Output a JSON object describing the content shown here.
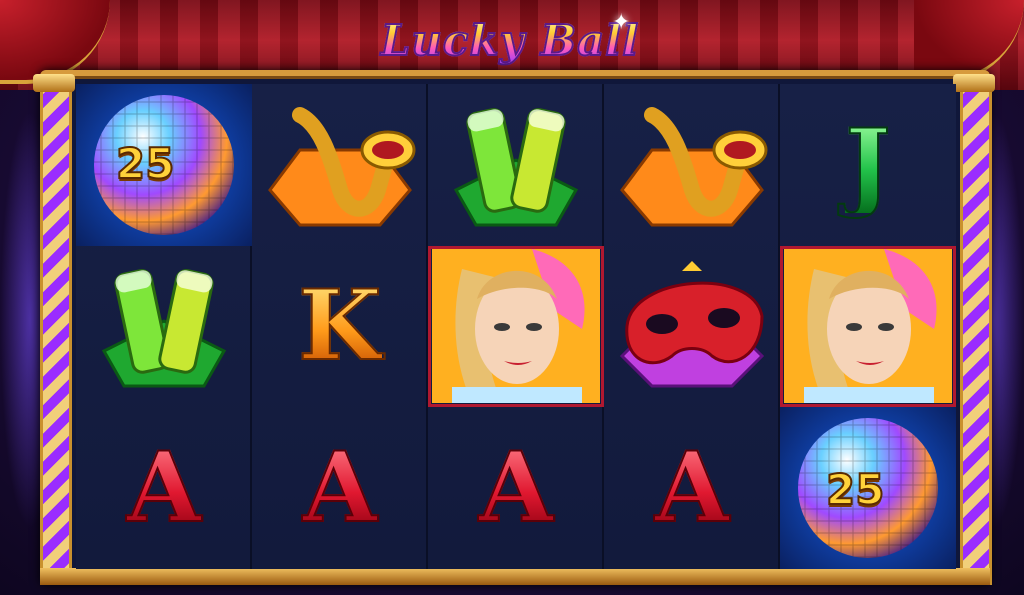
{
  "game": {
    "title": "Lucky Ball"
  },
  "reels": [
    [
      {
        "symbol": "disco-ball",
        "value": "25"
      },
      {
        "symbol": "champagne-glasses"
      },
      {
        "symbol": "letter-A",
        "label": "A"
      }
    ],
    [
      {
        "symbol": "saxophone"
      },
      {
        "symbol": "letter-K",
        "label": "K"
      },
      {
        "symbol": "letter-A",
        "label": "A"
      }
    ],
    [
      {
        "symbol": "champagne-glasses"
      },
      {
        "symbol": "showgirl"
      },
      {
        "symbol": "letter-A",
        "label": "A"
      }
    ],
    [
      {
        "symbol": "saxophone"
      },
      {
        "symbol": "masquerade-mask"
      },
      {
        "symbol": "letter-A",
        "label": "A"
      }
    ],
    [
      {
        "symbol": "letter-J",
        "label": "J"
      },
      {
        "symbol": "showgirl"
      },
      {
        "symbol": "disco-ball",
        "value": "25"
      }
    ]
  ],
  "colors": {
    "frame_gold": "#d79a3c",
    "reel_bg": "#172046",
    "curtain_red": "#b01824",
    "ace_red": "#e01830",
    "king_orange": "#ff9a1a",
    "jack_green": "#22c24a"
  }
}
